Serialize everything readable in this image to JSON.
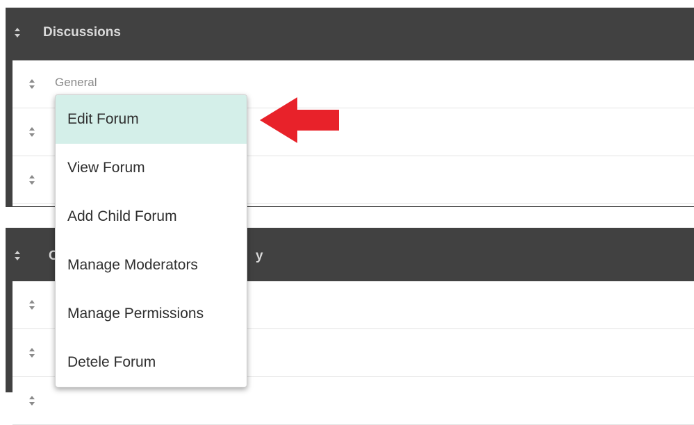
{
  "categories": [
    {
      "title": "Discussions",
      "forums": [
        {
          "label": "General"
        },
        {
          "label": ""
        },
        {
          "label": ""
        }
      ]
    },
    {
      "title": "C",
      "title_tail": "y",
      "forums": [
        {
          "label": ""
        },
        {
          "label": ""
        },
        {
          "label": ""
        }
      ]
    }
  ],
  "context_menu": {
    "items": [
      {
        "label": "Edit Forum",
        "active": true
      },
      {
        "label": "View Forum",
        "active": false
      },
      {
        "label": "Add Child Forum",
        "active": false
      },
      {
        "label": "Manage Moderators",
        "active": false
      },
      {
        "label": "Manage Permissions",
        "active": false
      },
      {
        "label": "Detele Forum",
        "active": false
      }
    ]
  },
  "colors": {
    "category_bg": "#414141",
    "menu_active_bg": "#d4efe9",
    "annotation_arrow": "#e8222a"
  },
  "icons": {
    "sort_handle": "sort-arrows-icon",
    "annotation": "red-arrow-left-icon"
  }
}
